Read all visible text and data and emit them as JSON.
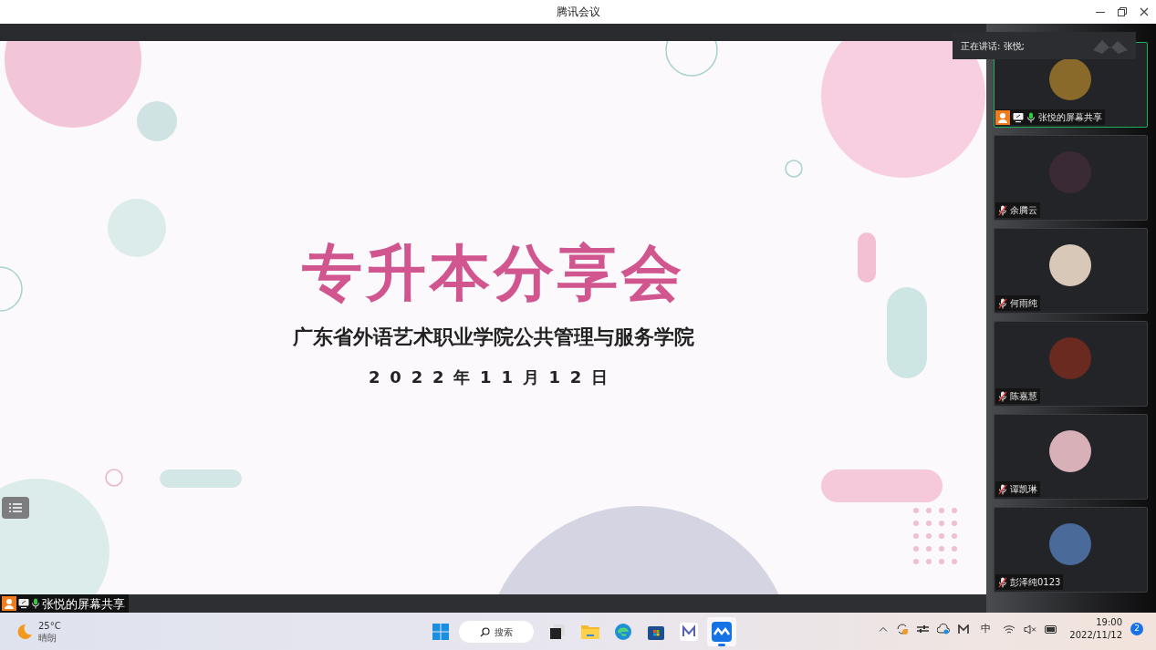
{
  "window": {
    "title": "腾讯会议"
  },
  "slide": {
    "title": "专升本分享会",
    "subtitle": "广东省外语艺术职业学院公共管理与服务学院",
    "date": "2022年11月12日"
  },
  "speaking_banner": {
    "text": "正在讲话: 张悦;"
  },
  "participants": [
    {
      "name": "张悦的屏幕共享",
      "speaking": true,
      "muted": false,
      "host": true,
      "sharing": true
    },
    {
      "name": "余腾云",
      "speaking": false,
      "muted": true,
      "host": false,
      "sharing": false
    },
    {
      "name": "何雨纯",
      "speaking": false,
      "muted": true,
      "host": false,
      "sharing": false
    },
    {
      "name": "陈嘉慧",
      "speaking": false,
      "muted": true,
      "host": false,
      "sharing": false
    },
    {
      "name": "谭凯琳",
      "speaking": false,
      "muted": true,
      "host": false,
      "sharing": false
    },
    {
      "name": "彭泽纯0123",
      "speaking": false,
      "muted": true,
      "host": false,
      "sharing": false
    }
  ],
  "share_label": {
    "name": "张悦的屏幕共享"
  },
  "taskbar": {
    "weather": {
      "temperature": "25°C",
      "condition": "晴朗"
    },
    "search": "搜索",
    "apps": [
      {
        "kind": "task-view",
        "selected": false
      },
      {
        "kind": "folder",
        "selected": false
      },
      {
        "kind": "browser",
        "selected": false
      },
      {
        "kind": "store",
        "selected": false
      },
      {
        "kind": "m-app",
        "selected": false
      },
      {
        "kind": "meeting",
        "selected": true
      }
    ],
    "ime": "中",
    "time": "19:00",
    "date": "2022/11/12",
    "notifications": "2"
  }
}
